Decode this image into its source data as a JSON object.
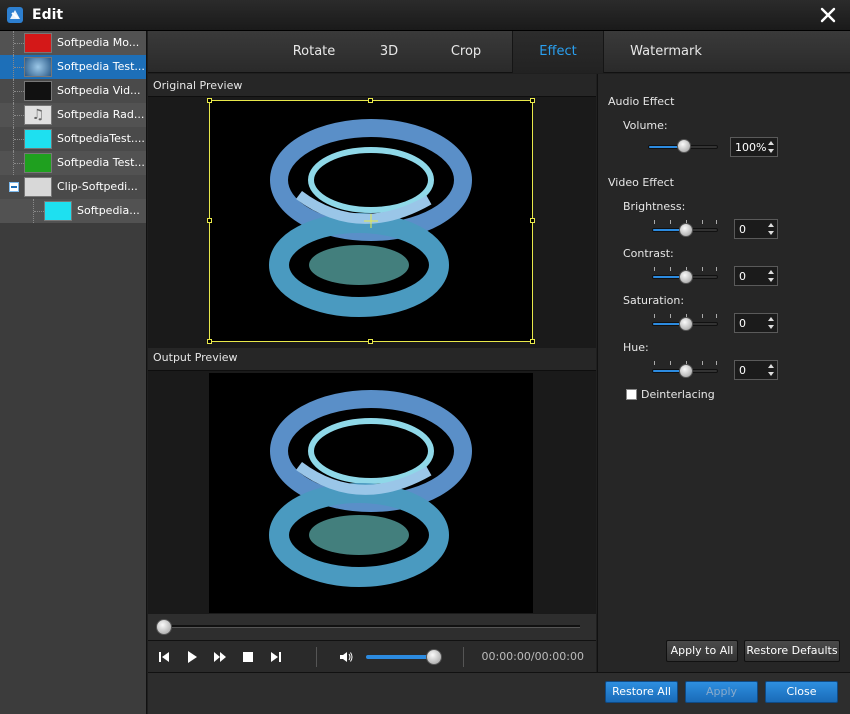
{
  "window": {
    "title": "Edit"
  },
  "sidebar": {
    "items": [
      {
        "label": "Softpedia Mo...",
        "thumb_color": "#d41818"
      },
      {
        "label": "Softpedia Test...",
        "thumb_color": "#4a7fa8"
      },
      {
        "label": "Softpedia Vid...",
        "thumb_color": "#111111"
      },
      {
        "label": "Softpedia Rad...",
        "thumb_color": "#e0e0e0"
      },
      {
        "label": "SoftpediaTest....",
        "thumb_color": "#1ee0f0"
      },
      {
        "label": "Softpedia Test...",
        "thumb_color": "#1fa01f"
      },
      {
        "label": "Clip-Softpedi...",
        "thumb_color": "#d8d8d8"
      },
      {
        "label": "Softpedia...",
        "thumb_color": "#1ee0f0"
      }
    ]
  },
  "tabs": [
    {
      "label": "Rotate"
    },
    {
      "label": "3D"
    },
    {
      "label": "Crop"
    },
    {
      "label": "Effect"
    },
    {
      "label": "Watermark"
    }
  ],
  "active_tab": "Effect",
  "preview": {
    "original_label": "Original Preview",
    "output_label": "Output Preview",
    "time": "00:00:00/00:00:00",
    "seek_progress": 0,
    "player_volume": 1.0
  },
  "effects": {
    "audio_title": "Audio Effect",
    "volume_label": "Volume:",
    "volume_value": "100%",
    "video_title": "Video Effect",
    "brightness_label": "Brightness:",
    "brightness_value": "0",
    "contrast_label": "Contrast:",
    "contrast_value": "0",
    "saturation_label": "Saturation:",
    "saturation_value": "0",
    "hue_label": "Hue:",
    "hue_value": "0",
    "deinterlacing_label": "Deinterlacing",
    "deinterlacing_checked": false
  },
  "buttons": {
    "apply_to_all": "Apply to All",
    "restore_defaults": "Restore Defaults",
    "restore_all": "Restore All",
    "apply": "Apply",
    "close": "Close"
  },
  "colors": {
    "accent": "#2c8be0",
    "tab_active": "#2aa0f0",
    "crop_frame": "#e8e84a"
  }
}
